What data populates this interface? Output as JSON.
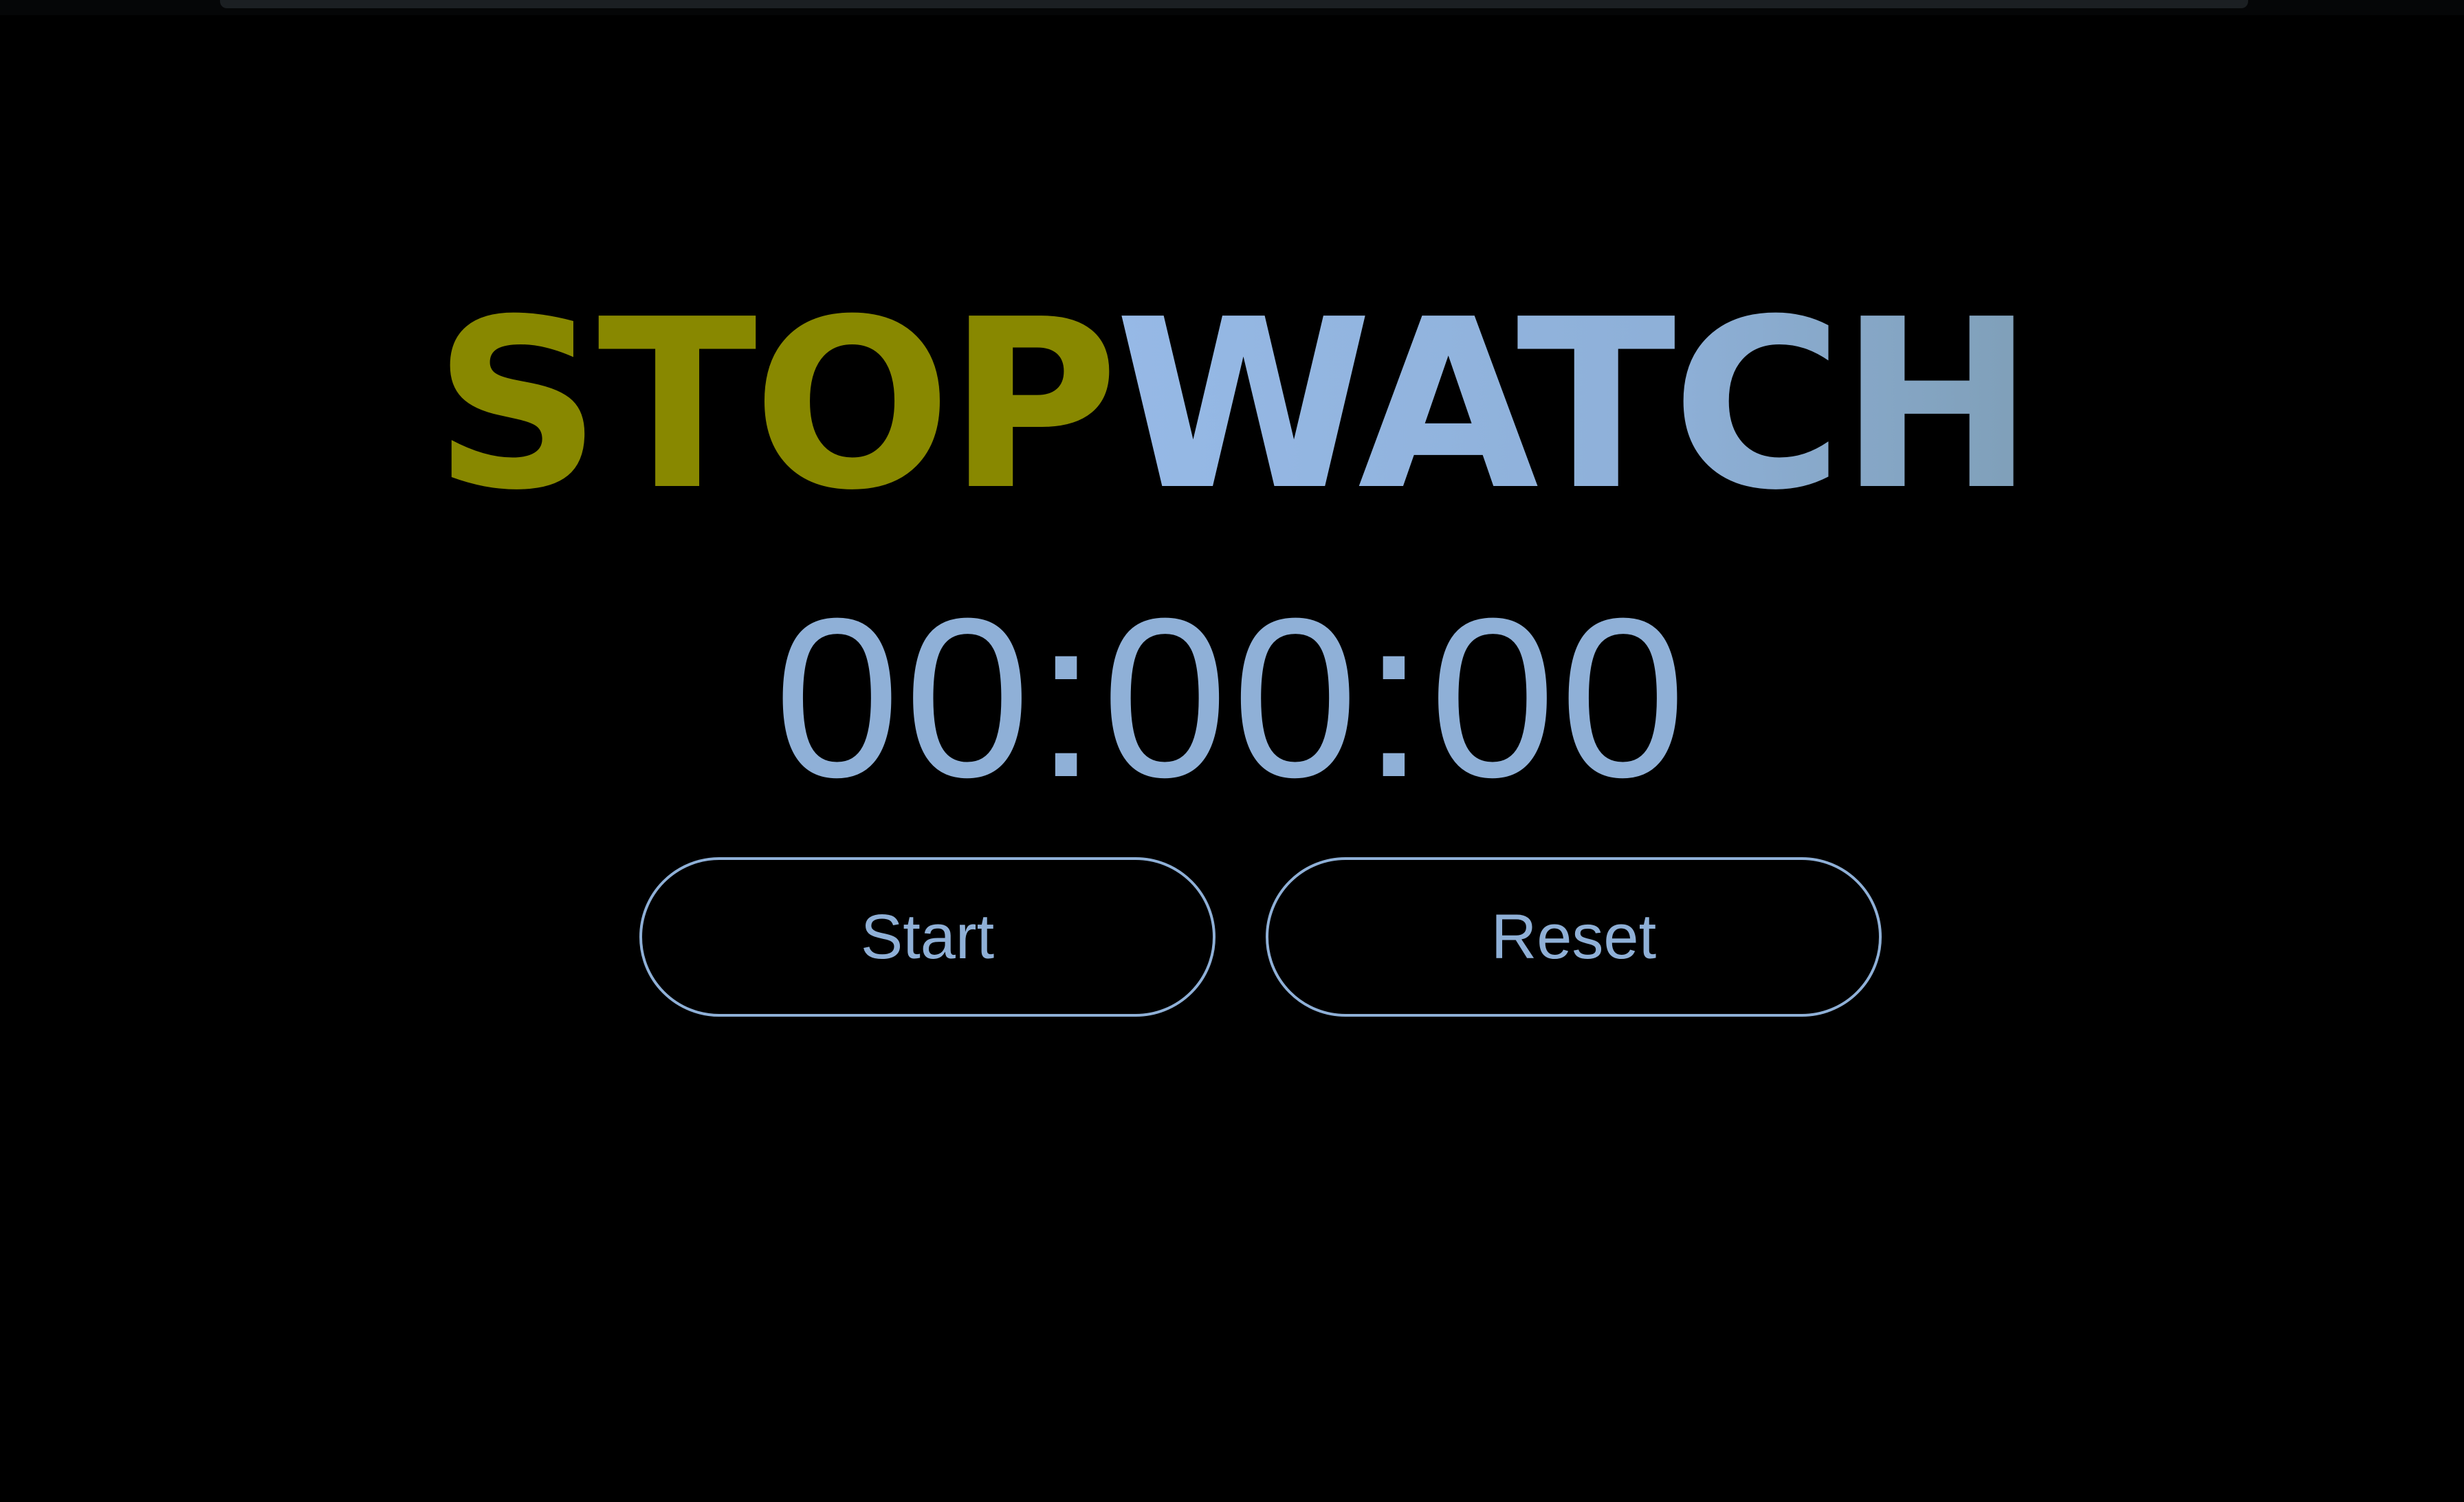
{
  "title": {
    "part1": "STOP",
    "part2": "WATCH"
  },
  "timer": {
    "display": "00:00:00"
  },
  "controls": {
    "start_label": "Start",
    "reset_label": "Reset"
  },
  "colors": {
    "background": "#000000",
    "title_stop": "#888800",
    "accent_blue": "#8fb0d7"
  }
}
